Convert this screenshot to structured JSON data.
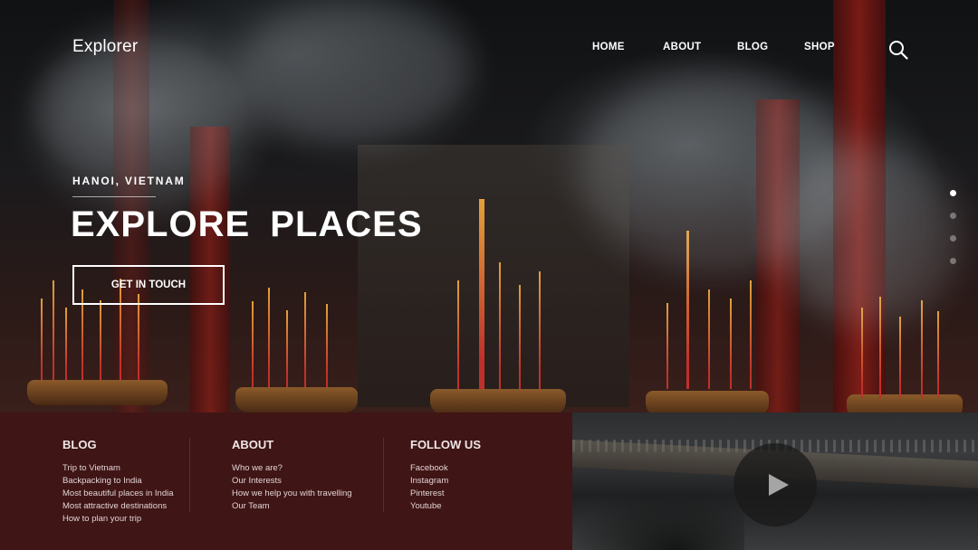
{
  "header": {
    "logo": "Explorer",
    "nav": [
      {
        "label": "HOME"
      },
      {
        "label": "ABOUT"
      },
      {
        "label": "BLOG"
      },
      {
        "label": "SHOP"
      }
    ],
    "search_icon": "search-icon"
  },
  "hero": {
    "kicker": "HANOI, VIETNAM",
    "headline": "EXPLORE PLACES",
    "cta": "GET IN TOUCH",
    "slides": {
      "count": 4,
      "active": 1
    }
  },
  "footer": {
    "columns": [
      {
        "title": "BLOG",
        "links": [
          "Trip to Vietnam",
          "Backpacking to India",
          "Most beautiful places in India",
          "Most attractive destinations",
          "How to plan your trip"
        ]
      },
      {
        "title": "ABOUT",
        "links": [
          "Who we are?",
          "Our Interests",
          "How we help you with travelling",
          "Our Team"
        ]
      },
      {
        "title": "FOLLOW US",
        "links": [
          "Facebook",
          "Instagram",
          "Pinterest",
          "Youtube"
        ]
      }
    ]
  },
  "video": {
    "play_icon": "play-icon"
  },
  "colors": {
    "footer_bg": "#3f1516",
    "accent": "#8a1d16"
  }
}
